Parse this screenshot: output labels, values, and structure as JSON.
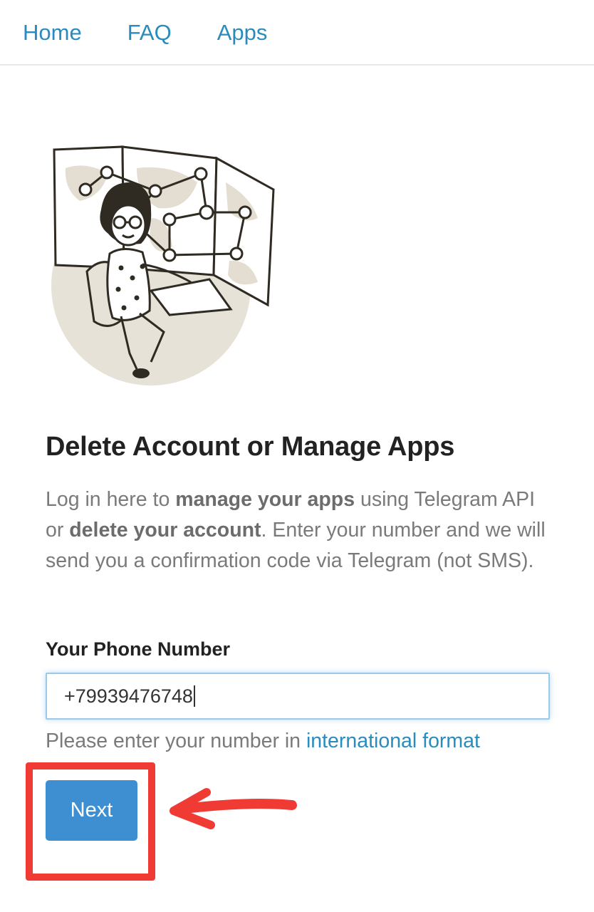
{
  "nav": {
    "home": "Home",
    "faq": "FAQ",
    "apps": "Apps"
  },
  "main": {
    "title": "Delete Account or Manage Apps",
    "desc": {
      "p1": "Log in here to ",
      "b1": "manage your apps",
      "p2": " using Telegram API or ",
      "b2": "delete your account",
      "p3": ". Enter your number and we will send you a confirmation code via Telegram (not SMS)."
    },
    "phone_label": "Your Phone Number",
    "phone_value": "+79939476748",
    "hint_text": "Please enter your number in ",
    "hint_link": "international format",
    "next_label": "Next"
  },
  "colors": {
    "link": "#2a8bbf",
    "button": "#3d8fd1",
    "annotation": "#ef3b34"
  }
}
